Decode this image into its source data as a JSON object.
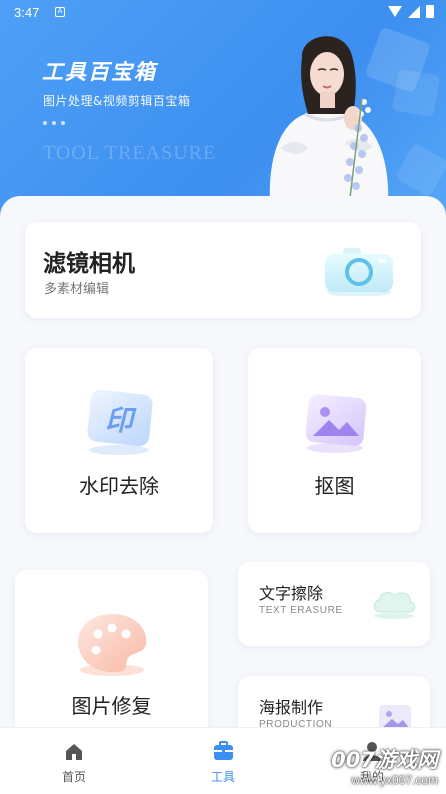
{
  "status_bar": {
    "time": "3:47"
  },
  "header": {
    "title": "工具百宝箱",
    "subtitle": "图片处理&视频剪辑百宝箱",
    "watermark": "TOOL TREASURE"
  },
  "camera_card": {
    "title": "滤镜相机",
    "subtitle": "多素材编辑"
  },
  "watermark_card": {
    "label": "水印去除",
    "icon_text": "印"
  },
  "cutout_card": {
    "label": "抠图"
  },
  "repair_card": {
    "label": "图片修复"
  },
  "text_card": {
    "title": "文字擦除",
    "subtitle": "TEXT ERASURE"
  },
  "poster_card": {
    "title": "海报制作",
    "subtitle": "PRODUCTION"
  },
  "nav": {
    "items": [
      {
        "label": "首页",
        "icon": "home-icon",
        "active": false
      },
      {
        "label": "工具",
        "icon": "toolbox-icon",
        "active": true
      },
      {
        "label": "我的",
        "icon": "user-icon",
        "active": false
      }
    ]
  },
  "brand_watermark": {
    "name": "007游戏网",
    "url": "www.yx007.com"
  },
  "colors": {
    "primary": "#3b8ff0",
    "active_nav": "#3b8ff0",
    "inactive_nav": "#555555"
  }
}
